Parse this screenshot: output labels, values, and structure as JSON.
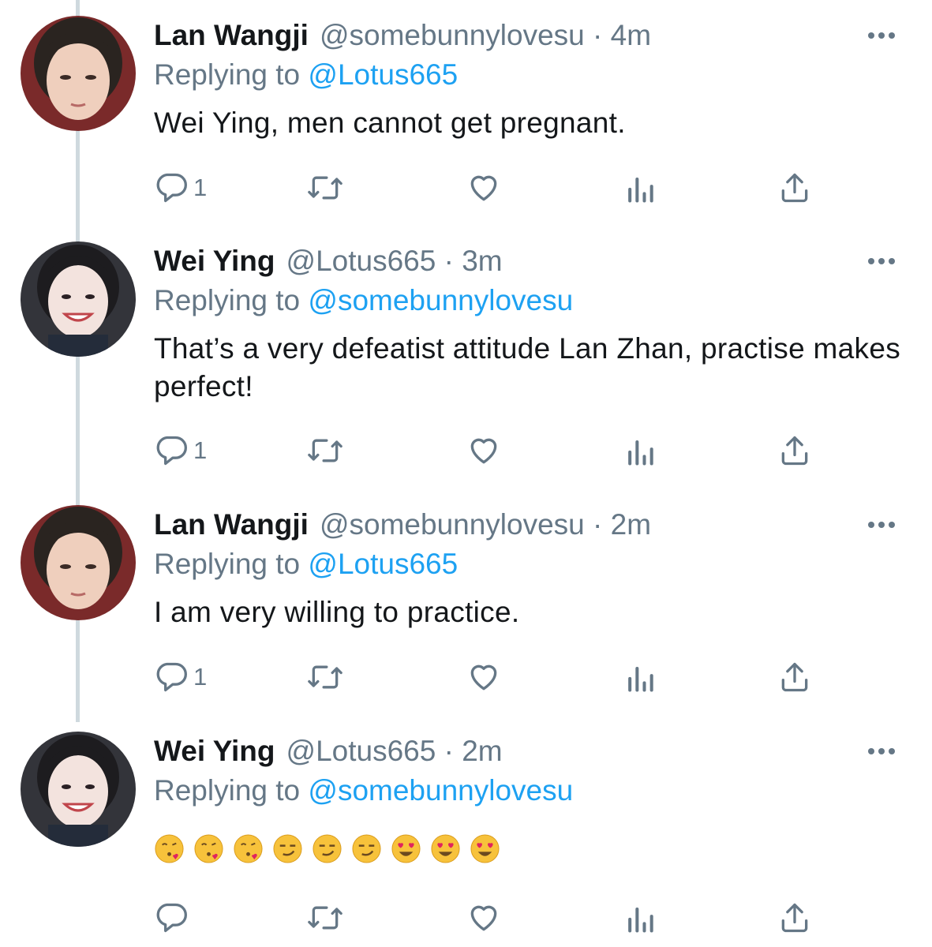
{
  "colors": {
    "name": "#14171a",
    "muted": "#657786",
    "link": "#1da1f2",
    "thread": "#cfd9de"
  },
  "icons": {
    "reply": "reply-icon",
    "retweet": "retweet-icon",
    "like": "heart-icon",
    "views": "views-icon",
    "share": "share-icon",
    "more": "more-icon"
  },
  "tweets": [
    {
      "name": "Lan Wangji",
      "handle": "@somebunnylovesu · 4m",
      "replying_prefix": "Replying to",
      "replying_to": "@Lotus665",
      "text": "Wei Ying, men cannot get pregnant.",
      "reply_count": "1"
    },
    {
      "name": "Wei Ying",
      "handle": "@Lotus665 · 3m",
      "replying_prefix": "Replying to",
      "replying_to": "@somebunnylovesu",
      "text": "That’s a very defeatist attitude Lan Zhan, practise makes perfect!",
      "reply_count": "1"
    },
    {
      "name": "Lan Wangji",
      "handle": "@somebunnylovesu · 2m",
      "replying_prefix": "Replying to",
      "replying_to": "@Lotus665",
      "text": "I am very willing to practice.",
      "reply_count": "1"
    },
    {
      "name": "Wei Ying",
      "handle": "@Lotus665 · 2m",
      "replying_prefix": "Replying to",
      "replying_to": "@somebunnylovesu",
      "emojis": [
        "face-blowing-kiss",
        "face-blowing-kiss",
        "face-blowing-kiss",
        "smirking-face",
        "smirking-face",
        "smirking-face",
        "heart-eyes",
        "heart-eyes",
        "heart-eyes"
      ],
      "reply_count": ""
    }
  ]
}
